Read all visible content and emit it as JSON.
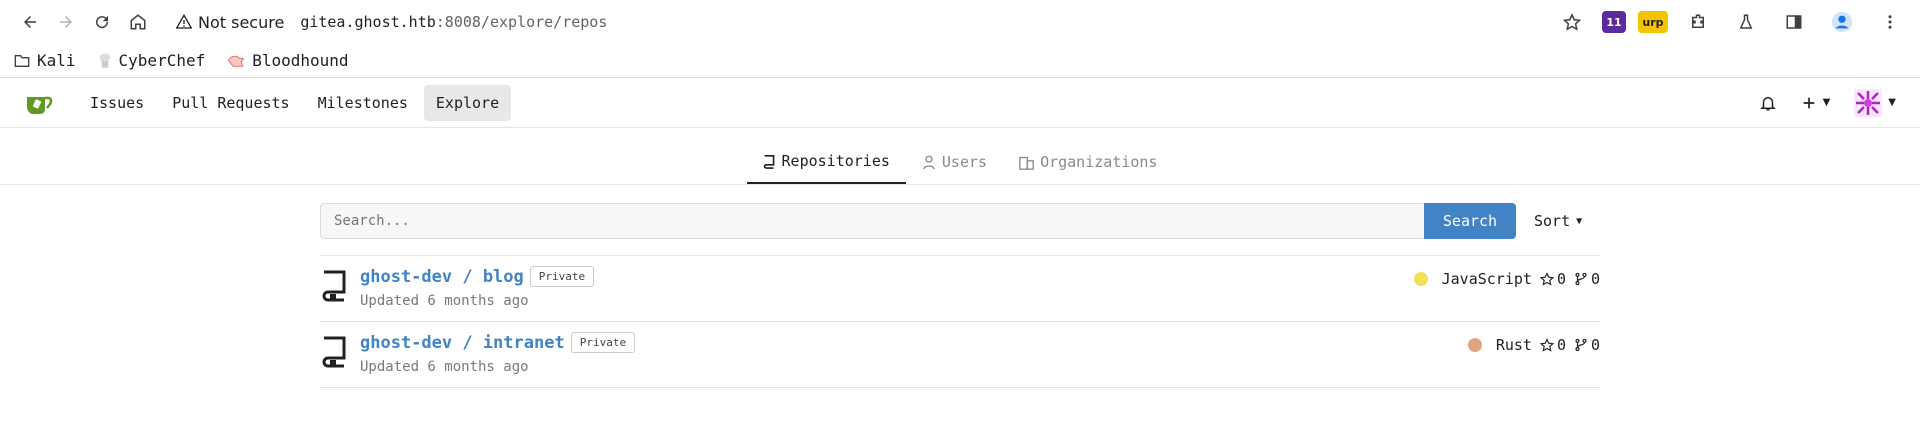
{
  "browser": {
    "security_label": "Not secure",
    "url_host": "gitea.ghost.htb",
    "url_rest": ":8008/explore/repos",
    "extensions": [
      {
        "label": "11",
        "color": "#5b2a9e"
      },
      {
        "label": "urp",
        "color": "#f5c400"
      }
    ]
  },
  "bookmarks": [
    {
      "label": "Kali",
      "icon": "folder-icon"
    },
    {
      "label": "CyberChef",
      "icon": "cyberchef-icon"
    },
    {
      "label": "Bloodhound",
      "icon": "bloodhound-icon"
    }
  ],
  "nav": {
    "items": [
      {
        "label": "Issues"
      },
      {
        "label": "Pull Requests"
      },
      {
        "label": "Milestones"
      },
      {
        "label": "Explore",
        "active": true
      }
    ]
  },
  "tabs": [
    {
      "label": "Repositories",
      "active": true,
      "icon": "repo-icon"
    },
    {
      "label": "Users",
      "active": false,
      "icon": "user-icon"
    },
    {
      "label": "Organizations",
      "active": false,
      "icon": "org-icon"
    }
  ],
  "search": {
    "placeholder": "Search...",
    "button_label": "Search",
    "sort_label": "Sort"
  },
  "repos": [
    {
      "name": "ghost-dev / blog",
      "visibility": "Private",
      "updated": "Updated 6 months ago",
      "language": "JavaScript",
      "language_color": "#f1e05a",
      "stars": "0",
      "forks": "0"
    },
    {
      "name": "ghost-dev / intranet",
      "visibility": "Private",
      "updated": "Updated 6 months ago",
      "language": "Rust",
      "language_color": "#dea584",
      "stars": "0",
      "forks": "0"
    }
  ]
}
